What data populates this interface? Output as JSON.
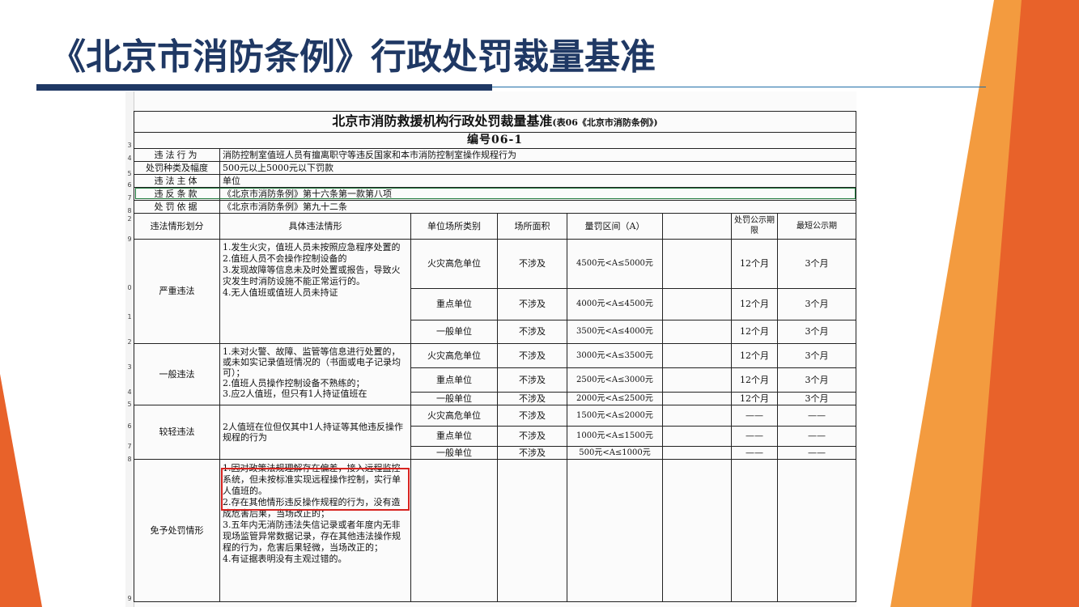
{
  "slide_title": "《北京市消防条例》行政处罚裁量基准",
  "theme": {
    "title_color": "#1f3864",
    "accent_orange": "#e8622a",
    "highlight_red": "#d7231f"
  },
  "sheet": {
    "heading_main": "北京市消防救援机构行政处罚裁量基准",
    "heading_sub": "(表06《北京市消防条例》)",
    "code": "编号06-1",
    "info_rows": [
      {
        "label": "违法行为",
        "value": "消防控制室值班人员有擅离职守等违反国家和本市消防控制室操作规程行为"
      },
      {
        "label": "处罚种类及幅度",
        "value": "500元以上5000元以下罚款"
      },
      {
        "label": "违法主体",
        "value": "单位"
      },
      {
        "label": "违反条款",
        "value": "《北京市消防条例》第十六条第一款第八项"
      },
      {
        "label": "处罚依据",
        "value": "《北京市消防条例》第九十二条"
      }
    ],
    "columns": [
      "违法情形划分",
      "具体违法情形",
      "单位场所类别",
      "场所面积",
      "量罚区间（A）",
      "",
      "处罚公示期限",
      "最短公示期"
    ],
    "groups": [
      {
        "category": "严重违法",
        "desc": [
          "1.发生火灾，值班人员未按照应急程序处置的",
          "2.值班人员不会操作控制设备的",
          "3.发现故障等信息未及时处置或报告，导致火灾发生时消防设施不能正常运行的。",
          "4.无人值班或值班人员未持证"
        ],
        "rows": [
          {
            "type": "火灾高危单位",
            "area": "不涉及",
            "range": "4500元<A≤5000元",
            "period": "12个月",
            "min": "3个月"
          },
          {
            "type": "重点单位",
            "area": "不涉及",
            "range": "4000元<A≤4500元",
            "period": "12个月",
            "min": "3个月"
          },
          {
            "type": "一般单位",
            "area": "不涉及",
            "range": "3500元<A≤4000元",
            "period": "12个月",
            "min": "3个月"
          }
        ]
      },
      {
        "category": "一般违法",
        "desc": [
          "1.未对火警、故障、监管等信息进行处置的，或未如实记录值班情况的（书面或电子记录均可）；",
          "2.值班人员操作控制设备不熟练的；",
          "3.应2人值班，但只有1人持证值班在"
        ],
        "rows": [
          {
            "type": "火灾高危单位",
            "area": "不涉及",
            "range": "3000元<A≤3500元",
            "period": "12个月",
            "min": "3个月"
          },
          {
            "type": "重点单位",
            "area": "不涉及",
            "range": "2500元<A≤3000元",
            "period": "12个月",
            "min": "3个月"
          },
          {
            "type": "一般单位",
            "area": "不涉及",
            "range": "2000元<A≤2500元",
            "period": "12个月",
            "min": "3个月"
          }
        ]
      },
      {
        "category": "较轻违法",
        "desc": [
          "2人值班在位但仅其中1人持证等其他违反操作规程的行为"
        ],
        "rows": [
          {
            "type": "火灾高危单位",
            "area": "不涉及",
            "range": "1500元<A≤2000元",
            "period": "——",
            "min": "——"
          },
          {
            "type": "重点单位",
            "area": "不涉及",
            "range": "1000元<A≤1500元",
            "period": "——",
            "min": "——"
          },
          {
            "type": "一般单位",
            "area": "不涉及",
            "range": "500元<A≤1000元",
            "period": "——",
            "min": "——"
          }
        ]
      }
    ],
    "exempt": {
      "category": "免予处罚情形",
      "desc": [
        "1.因对政策法规理解存在偏差，接入远程监控系统，但未按标准实现远程操作控制，实行单人值班的。",
        "2.存在其他情形违反操作规程的行为，没有造成危害后果，当场改正的；",
        "3.五年内无消防违法失信记录或者年度内无非现场监管异常数据记录，存在其他违法操作规程的行为，危害后果轻微，当场改正的；",
        "4.有证据表明没有主观过错的。"
      ]
    },
    "row_numbers": [
      "2",
      "3",
      "4",
      "5",
      "6",
      "7",
      "8",
      "9",
      "0",
      "1",
      "2",
      "3",
      "4",
      "5",
      "6",
      "7",
      "8",
      "9"
    ]
  }
}
